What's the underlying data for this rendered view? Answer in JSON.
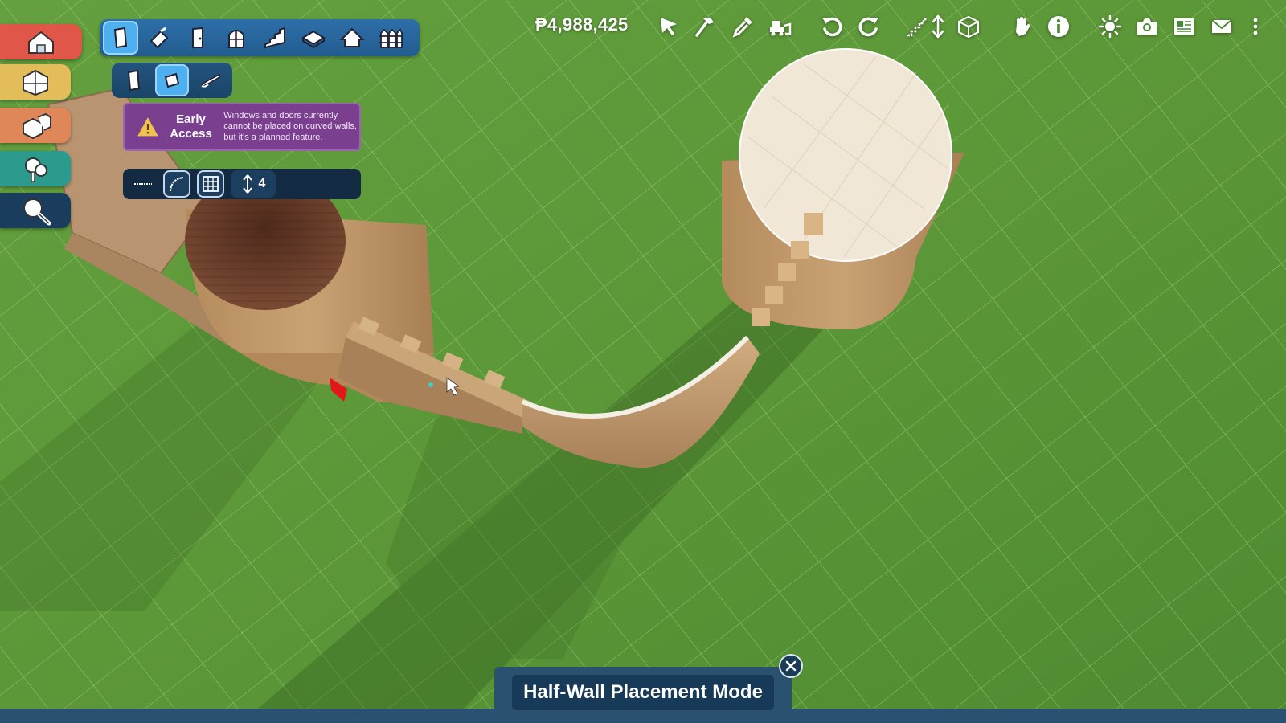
{
  "hud": {
    "funds": "₱4,988,425"
  },
  "early_access": {
    "title": "Early Access",
    "message": "Windows and doors currently cannot be placed on curved walls, but it's a planned feature."
  },
  "wall_options": {
    "height_value": "4"
  },
  "mode_banner": {
    "label": "Half-Wall Placement Mode"
  },
  "colors": {
    "grass": "#5f9a3a",
    "grid_line": "#a9d28a",
    "toolbar_blue": "#2e6fa8",
    "active_blue": "#4fb0f0",
    "early_access_purple": "#7b3f8f",
    "banner_navy": "#163a57",
    "stone": "#c39a6a",
    "roof_brown": "#6e3f2b",
    "tower_top": "#f1e7d6"
  },
  "icons": {
    "categories": [
      "house-build-icon",
      "rooms-icon",
      "furniture-icon",
      "landscaping-icon",
      "search-icon"
    ],
    "build_tools": [
      "wall-tool-icon",
      "paint-tool-icon",
      "door-tool-icon",
      "window-tool-icon",
      "stairs-tool-icon",
      "floor-tool-icon",
      "roof-tool-icon",
      "fence-tool-icon"
    ],
    "wall_types": [
      "full-wall-icon",
      "half-wall-icon",
      "wall-brush-icon"
    ],
    "wall_options": [
      "straight-wall-icon",
      "curved-wall-icon",
      "grid-snap-icon",
      "height-stepper-icon"
    ],
    "hud_tools": [
      "select-cursor-icon",
      "hammer-icon",
      "eyedropper-icon",
      "bulldoze-icon",
      "undo-icon",
      "redo-icon",
      "stairs-level-icon",
      "level-updown-icon",
      "wireframe-cube-icon",
      "hand-grab-icon",
      "info-icon",
      "sun-icon",
      "camera-icon",
      "newspaper-icon",
      "mail-icon",
      "more-menu-icon"
    ]
  }
}
